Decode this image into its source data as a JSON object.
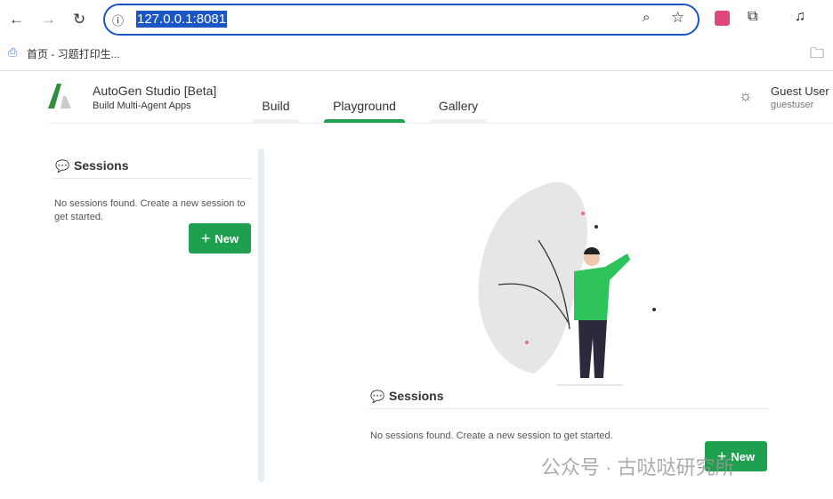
{
  "browser": {
    "url": "127.0.0.1:8081",
    "bookmark": "首页 - 习题打印生..."
  },
  "app": {
    "title": "AutoGen Studio [Beta]",
    "subtitle": "Build Multi-Agent Apps",
    "tabs": [
      {
        "label": "Build"
      },
      {
        "label": "Playground",
        "active": true
      },
      {
        "label": "Gallery"
      }
    ],
    "user": {
      "name": "Guest User",
      "username": "guestuser"
    }
  },
  "sidebar": {
    "title": "Sessions",
    "empty": "No sessions found. Create a new session to get started.",
    "new_label": "New"
  },
  "main": {
    "title": "Sessions",
    "empty": "No sessions found. Create a new session to get started.",
    "new_label": "New"
  },
  "watermark": "公众号 · 古哒哒研究所",
  "colors": {
    "accent": "#1fa04f",
    "url_highlight": "#1a56c4"
  }
}
